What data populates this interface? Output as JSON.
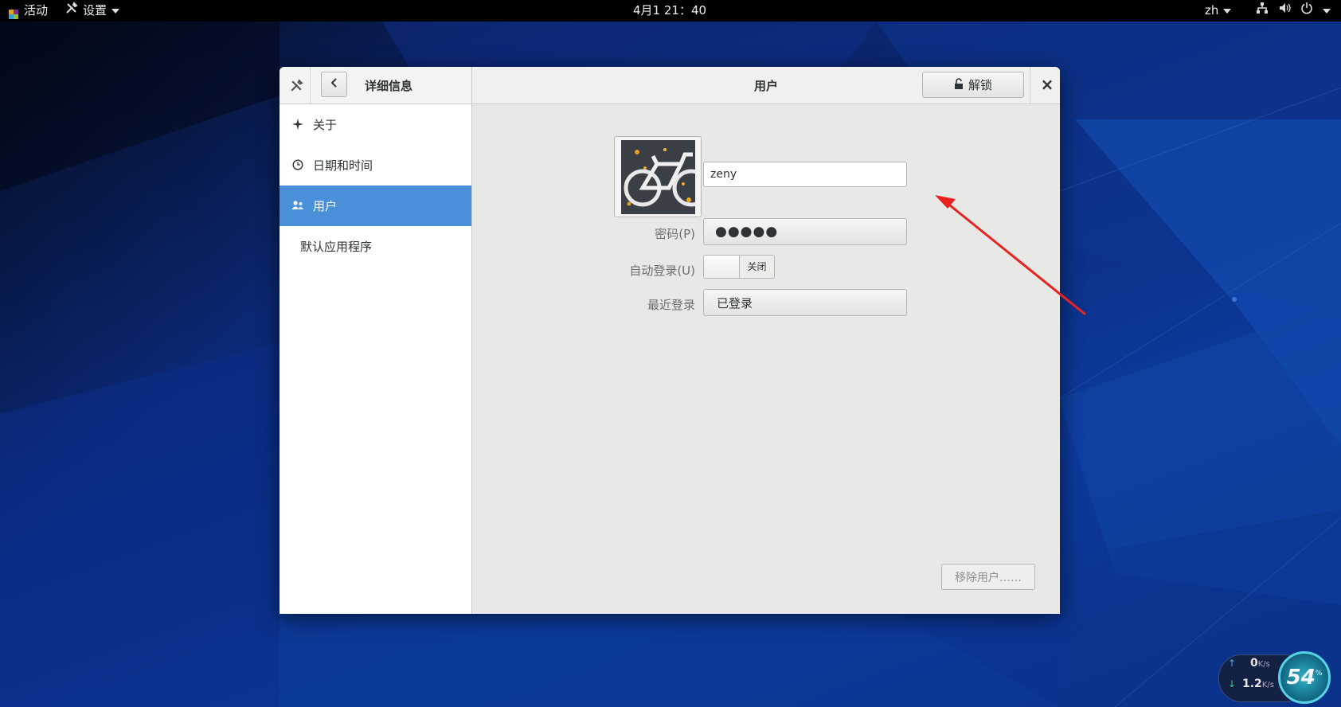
{
  "topbar": {
    "activities": "活动",
    "app_menu": "设置",
    "clock": "4月1  21：40",
    "language": "zh"
  },
  "window": {
    "sidebar_title": "详细信息",
    "content_title": "用户",
    "unlock_label": "解锁",
    "close_symbol": "×"
  },
  "sidebar": {
    "items": [
      {
        "label": "关于",
        "icon": "sparkle-icon"
      },
      {
        "label": "日期和时间",
        "icon": "clock-icon"
      },
      {
        "label": "用户",
        "icon": "users-icon",
        "active": true
      },
      {
        "label": "默认应用程序",
        "icon": ""
      }
    ]
  },
  "user": {
    "name": "zeny",
    "password_label": "密码(P)",
    "password_value": "●●●●●",
    "autologin_label": "自动登录(U)",
    "autologin_state": "关闭",
    "last_login_label": "最近登录",
    "last_login_value": "已登录",
    "remove_button": "移除用户……"
  },
  "netmonitor": {
    "up": "0",
    "up_unit": "K/s",
    "down": "1.2",
    "down_unit": "K/s",
    "percent": "54",
    "percent_unit": "%"
  },
  "colors": {
    "accent": "#4a90d9",
    "annotation_arrow": "#e8231f"
  }
}
